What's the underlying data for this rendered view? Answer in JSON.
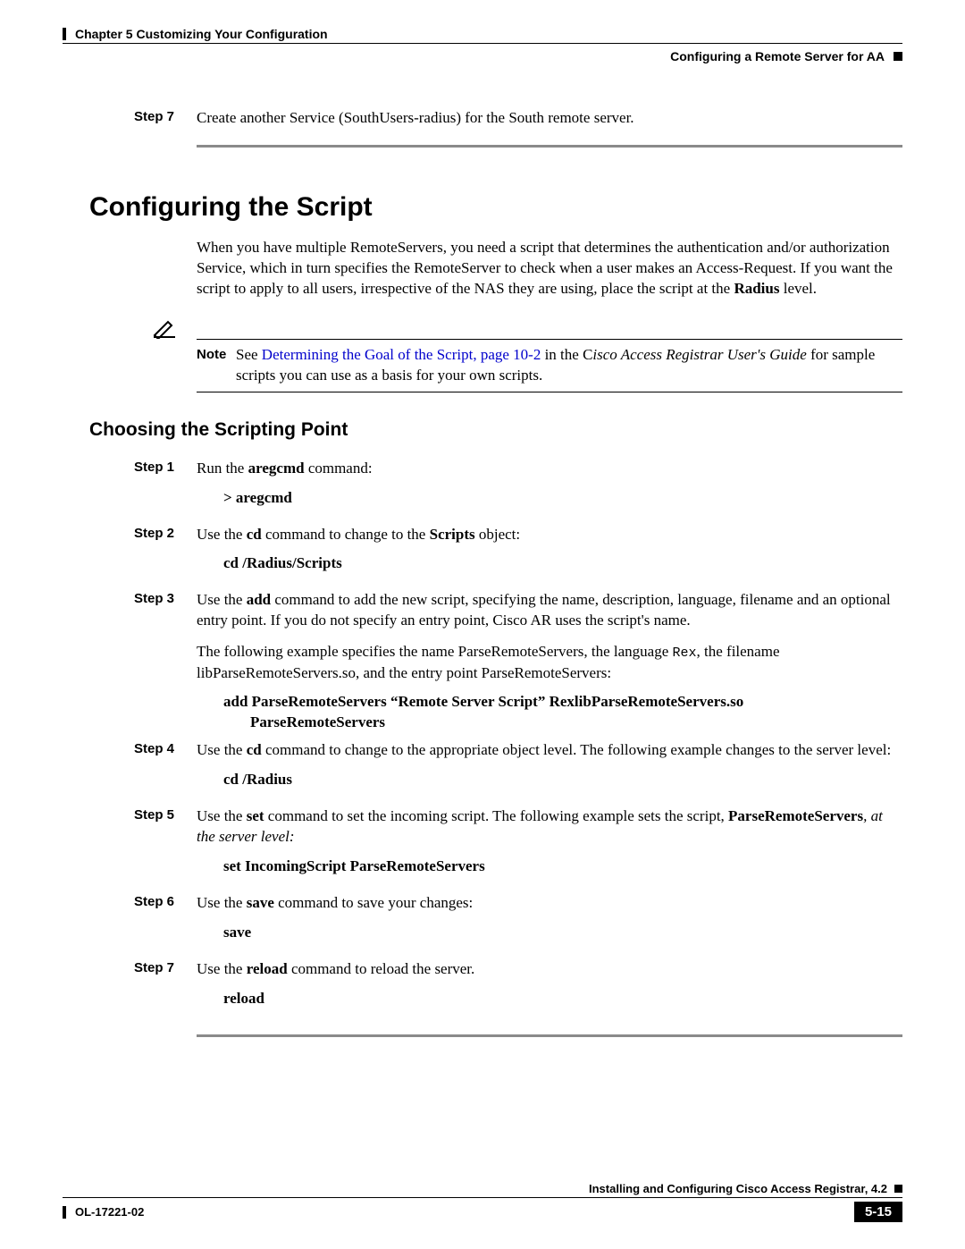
{
  "header": {
    "chapter": "Chapter 5    Customizing Your Configuration",
    "section": "Configuring a Remote Server for AA"
  },
  "top_step": {
    "label": "Step 7",
    "text": "Create another Service (SouthUsers-radius) for the South remote server."
  },
  "h1": "Configuring the Script",
  "intro": {
    "p1": "When you have multiple RemoteServers, you need a script that determines the authentication and/or authorization Service, which in turn specifies the RemoteServer to check when a user makes an Access-Request. If you want the script to apply to all users, irrespective of the NAS they are using, place the script at the ",
    "p1_bold": "Radius",
    "p1_after": " level."
  },
  "note": {
    "label": "Note",
    "pre": "See ",
    "link": "Determining the Goal of the Script, page 10-2",
    "mid": " in the C",
    "ital": "isco Access Registrar User's Guide",
    "post": " for sample scripts you can use as a basis for your own scripts."
  },
  "h2": "Choosing the Scripting Point",
  "steps": {
    "s1": {
      "label": "Step 1",
      "t1": "Run the ",
      "b1": "aregcmd",
      "t2": " command:",
      "cmd": "> aregcmd"
    },
    "s2": {
      "label": "Step 2",
      "t1": "Use the ",
      "b1": "cd",
      "t2": " command to change to the ",
      "b2": "Scripts",
      "t3": " object:",
      "cmd": "cd /Radius/Scripts"
    },
    "s3": {
      "label": "Step 3",
      "t1": "Use the ",
      "b1": "add",
      "t2": " command to add the new script, specifying the name, description, language, filename and an optional entry point. If you do not specify an entry point, Cisco AR uses the script's name.",
      "p2a": "The following example specifies the name ParseRemoteServers, the language ",
      "p2mono": "Rex",
      "p2b": ", the filename libParseRemoteServers.so, and the entry point ParseRemoteServers:",
      "cmd1": "add ParseRemoteServers “Remote Server Script” RexlibParseRemoteServers.so",
      "cmd2": "ParseRemoteServers"
    },
    "s4": {
      "label": "Step 4",
      "t1": "Use the ",
      "b1": "cd",
      "t2": " command to change to the appropriate object level. The following example changes to the server level:",
      "cmd": "cd /Radius"
    },
    "s5": {
      "label": "Step 5",
      "t1": "Use the ",
      "b1": "set",
      "t2": " command to set the incoming script. The following example sets the script, ",
      "b2": "ParseRemoteServers",
      "t3": ", at the server level:",
      "cmd": "set IncomingScript ParseRemoteServers"
    },
    "s6": {
      "label": "Step 6",
      "t1": "Use the ",
      "b1": "save",
      "t2": " command to save your changes:",
      "cmd": "save"
    },
    "s7": {
      "label": "Step 7",
      "t1": "Use the ",
      "b1": "reload",
      "t2": " command to reload the server.",
      "cmd": "reload"
    }
  },
  "footer": {
    "book": "Installing and Configuring Cisco Access Registrar, 4.2",
    "doc": "OL-17221-02",
    "page": "5-15"
  }
}
